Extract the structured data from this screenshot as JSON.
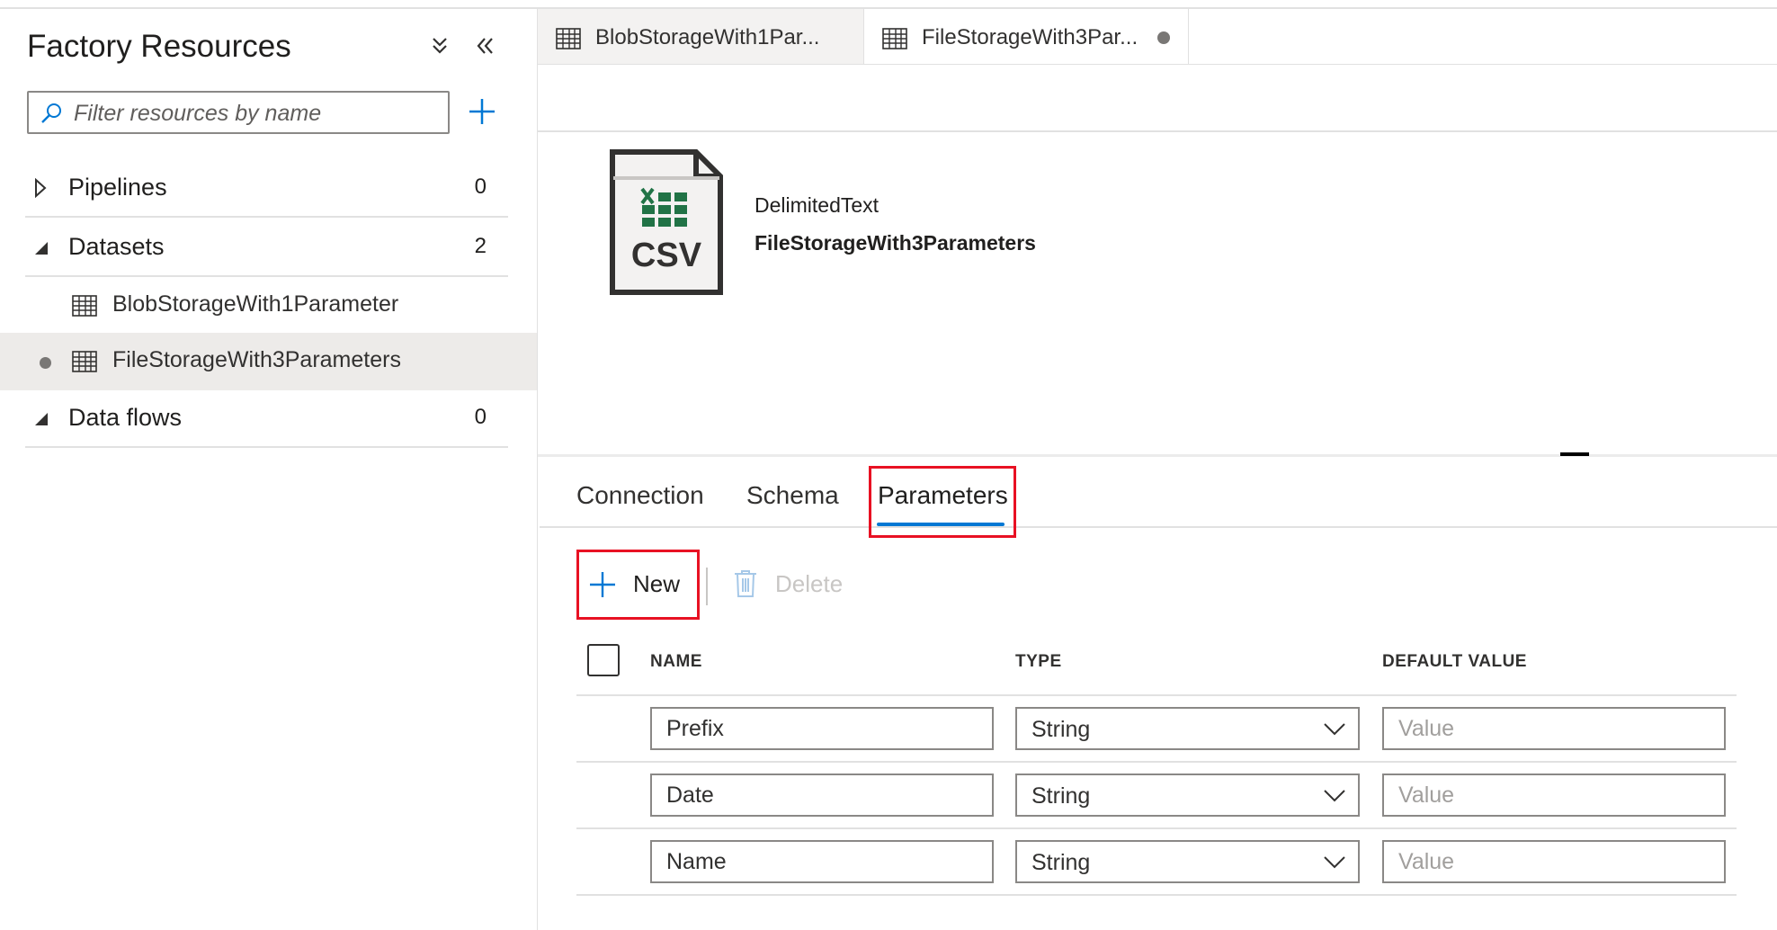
{
  "sidebar": {
    "title": "Factory Resources",
    "filter_placeholder": "Filter resources by name",
    "groups": [
      {
        "label": "Pipelines",
        "count": "0"
      },
      {
        "label": "Datasets",
        "count": "2"
      },
      {
        "label": "Data flows",
        "count": "0"
      }
    ],
    "datasets": [
      {
        "label": "BlobStorageWith1Parameter"
      },
      {
        "label": "FileStorageWith3Parameters"
      }
    ]
  },
  "tabs": [
    {
      "label": "BlobStorageWith1Par..."
    },
    {
      "label": "FileStorageWith3Par..."
    }
  ],
  "dataset": {
    "icon_text": "CSV",
    "type": "DelimitedText",
    "name": "FileStorageWith3Parameters"
  },
  "panel_tabs": [
    "Connection",
    "Schema",
    "Parameters"
  ],
  "commands": {
    "new_label": "New",
    "delete_label": "Delete"
  },
  "grid": {
    "headers": {
      "name": "NAME",
      "type": "TYPE",
      "default": "DEFAULT VALUE"
    },
    "value_placeholder": "Value",
    "rows": [
      {
        "name": "Prefix",
        "type": "String"
      },
      {
        "name": "Date",
        "type": "String"
      },
      {
        "name": "Name",
        "type": "String"
      }
    ]
  },
  "colors": {
    "accent": "#0078d4",
    "highlight": "#e81123",
    "excel_green": "#217346",
    "icon_dark": "#323130"
  }
}
